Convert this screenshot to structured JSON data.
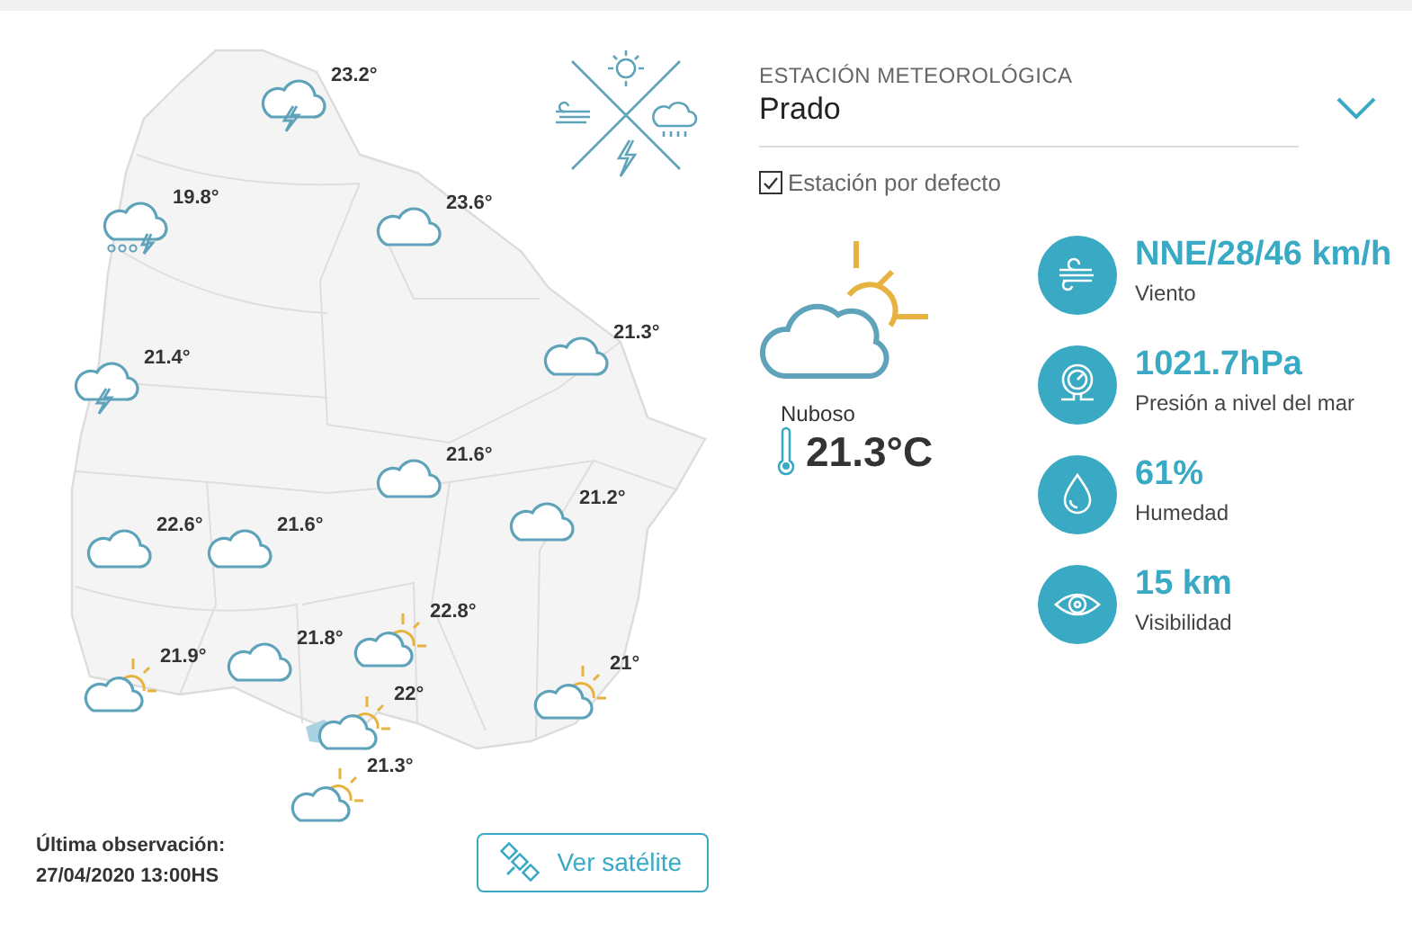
{
  "map": {
    "markers": [
      {
        "kind": "storm",
        "temp": "23.2°"
      },
      {
        "kind": "rain-storm",
        "temp": "19.8°"
      },
      {
        "kind": "cloud",
        "temp": "23.6°"
      },
      {
        "kind": "cloud",
        "temp": "21.3°"
      },
      {
        "kind": "storm",
        "temp": "21.4°"
      },
      {
        "kind": "cloud",
        "temp": "21.6°"
      },
      {
        "kind": "cloud",
        "temp": "21.2°"
      },
      {
        "kind": "cloud",
        "temp": "22.6°"
      },
      {
        "kind": "cloud",
        "temp": "21.6°"
      },
      {
        "kind": "cloud",
        "temp": "21.8°"
      },
      {
        "kind": "partly",
        "temp": "22.8°"
      },
      {
        "kind": "partly",
        "temp": "21.9°"
      },
      {
        "kind": "partly",
        "temp": "21°"
      },
      {
        "kind": "partly",
        "temp": "22°"
      },
      {
        "kind": "partly",
        "temp": "21.3°"
      }
    ]
  },
  "footer": {
    "label": "Última observación:",
    "timestamp": "27/04/2020 13:00HS"
  },
  "satellite_button": {
    "label": "Ver satélite"
  },
  "station": {
    "label": "ESTACIÓN METEOROLÓGICA",
    "value": "Prado"
  },
  "default_station": {
    "label": "Estación por defecto",
    "checked": true
  },
  "current": {
    "condition": "Nuboso",
    "temperature": "21.3°C"
  },
  "stats": [
    {
      "kind": "wind",
      "value": "NNE/28/46 km/h",
      "label": "Viento"
    },
    {
      "kind": "pressure",
      "value": "1021.7hPa",
      "label": "Presión a nivel del mar"
    },
    {
      "kind": "humidity",
      "value": "61%",
      "label": "Humedad"
    },
    {
      "kind": "visibility",
      "value": "15 km",
      "label": "Visibilidad"
    }
  ]
}
